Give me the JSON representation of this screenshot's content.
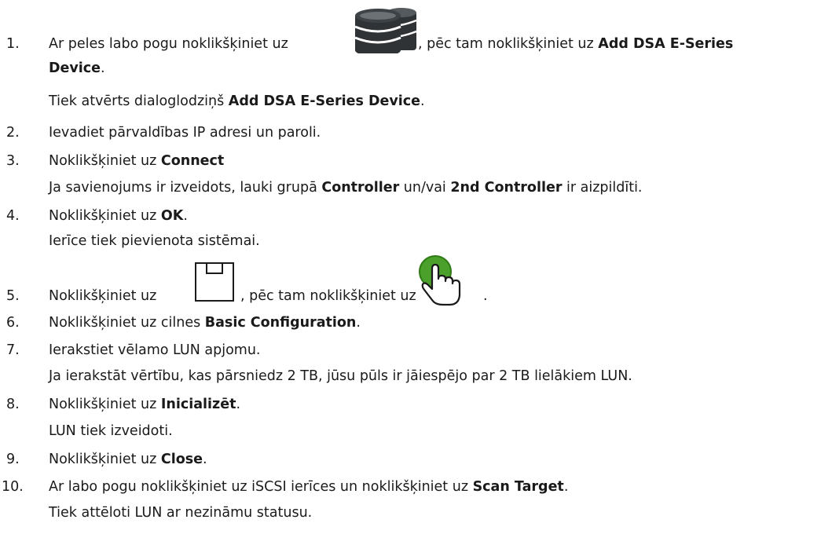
{
  "steps": [
    {
      "num": "1.",
      "l1_a": "Ar peles labo pogu noklikšķiniet uz",
      "l1_b": ", pēc tam noklikšķiniet uz ",
      "l1_bold": "Add DSA E-Series",
      "l2_bold": "Device",
      "l2_end": ".",
      "l3_a": "Tiek atvērts dialoglodziņš ",
      "l3_bold": "Add DSA E-Series Device",
      "l3_end": ".",
      "icon": "storage-database-icon"
    },
    {
      "num": "2.",
      "text": "Ievadiet pārvaldības IP adresi un paroli."
    },
    {
      "num": "3.",
      "l1_a": "Noklikšķiniet uz ",
      "l1_bold": "Connect",
      "l2_a": "Ja savienojums ir izveidots, lauki grupā ",
      "l2_bold1": "Controller",
      "l2_mid": " un/vai ",
      "l2_bold2": "2nd Controller",
      "l2_end": " ir aizpildīti."
    },
    {
      "num": "4.",
      "l1_a": "Noklikšķiniet uz ",
      "l1_bold": "OK",
      "l1_end": ".",
      "l2": "Ierīce tiek pievienota sistēmai."
    },
    {
      "num": "5.",
      "l1_a": "Noklikšķiniet uz",
      "l1_b": ", pēc tam noklikšķiniet uz",
      "l1_end": ".",
      "icon1": "save-icon",
      "icon2": "activate-hand-icon"
    },
    {
      "num": "6.",
      "l1_a": "Noklikšķiniet uz cilnes ",
      "l1_bold": "Basic Configuration",
      "l1_end": "."
    },
    {
      "num": "7.",
      "l1": "Ierakstiet vēlamo LUN apjomu.",
      "l2": "Ja ierakstāt vērtību, kas pārsniedz 2 TB, jūsu pūls ir jāiespējo par 2 TB lielākiem LUN."
    },
    {
      "num": "8.",
      "l1_a": "Noklikšķiniet uz ",
      "l1_bold": "Inicializēt",
      "l1_end": ".",
      "l2": "LUN tiek izveidoti."
    },
    {
      "num": "9.",
      "l1_a": "Noklikšķiniet uz ",
      "l1_bold": "Close",
      "l1_end": "."
    },
    {
      "num": "10.",
      "l1_a": "Ar labo pogu noklikšķiniet uz iSCSI ierīces un noklikšķiniet uz ",
      "l1_bold": "Scan Target",
      "l1_end": ".",
      "l2": "Tiek attēloti LUN ar nezināmu statusu."
    }
  ]
}
